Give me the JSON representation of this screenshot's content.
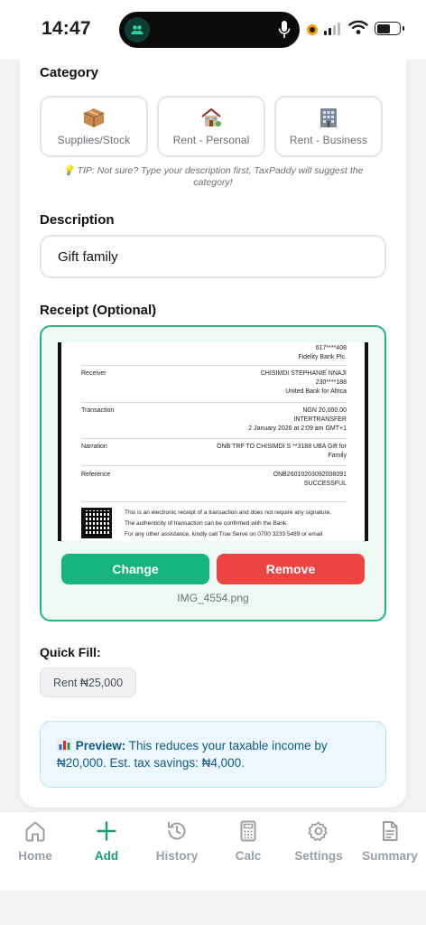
{
  "status_bar": {
    "time": "14:47"
  },
  "category": {
    "label": "Category",
    "options": [
      {
        "label": "Supplies/Stock",
        "icon": "package-icon"
      },
      {
        "label": "Rent - Personal",
        "icon": "house-icon"
      },
      {
        "label": "Rent - Business",
        "icon": "office-building-icon"
      }
    ],
    "tip": "💡 TIP: Not sure? Type your description first, TaxPaddy will suggest the category!"
  },
  "description": {
    "label": "Description",
    "value": "Gift family"
  },
  "receipt": {
    "label": "Receipt (Optional)",
    "image": {
      "sender_account": "617****408",
      "sender_bank": "Fidelity Bank Plc.",
      "receiver_label": "Receiver",
      "receiver_name": "CHISIMDI STEPHANIE NNAJI",
      "receiver_account": "230****188",
      "receiver_bank": "United Bank for Africa",
      "transaction_label": "Transaction",
      "transaction_amount": "NGN 20,000.00",
      "transaction_type": "INTERTRANSFER",
      "transaction_date": "2 January 2026 at 2:09 am GMT+1",
      "narration_label": "Narration",
      "narration_line1": "ONB TRF TO CHISIMDI S **3188 UBA Gift for",
      "narration_line2": "Family",
      "reference_label": "Reference",
      "reference_value": "ONB26010203092008091",
      "reference_status": "SUCCESSFUL",
      "footer_line1": "This is an electronic receipt of a transaction and does not require any signature.",
      "footer_line2": "The authenticity of transaction can be confirmed with the Bank.",
      "footer_line3": "For any other assistance, kindly call True Serve on 0700 3233 5489 or email"
    },
    "change_label": "Change",
    "remove_label": "Remove",
    "file_name": "IMG_4554.png"
  },
  "quick_fill": {
    "label": "Quick Fill:",
    "chip": "Rent ₦25,000"
  },
  "preview": {
    "icon": "bar-chart-icon",
    "title": "Preview:",
    "text": " This reduces your taxable income by ₦20,000. Est. tax savings: ₦4,000."
  },
  "nav": {
    "active_color": "#16a06d",
    "items": [
      {
        "label": "Home",
        "icon": "home-icon"
      },
      {
        "label": "Add",
        "icon": "plus-icon"
      },
      {
        "label": "History",
        "icon": "history-icon"
      },
      {
        "label": "Calc",
        "icon": "calculator-icon"
      },
      {
        "label": "Settings",
        "icon": "gear-icon"
      },
      {
        "label": "Summary",
        "icon": "document-icon"
      }
    ]
  }
}
